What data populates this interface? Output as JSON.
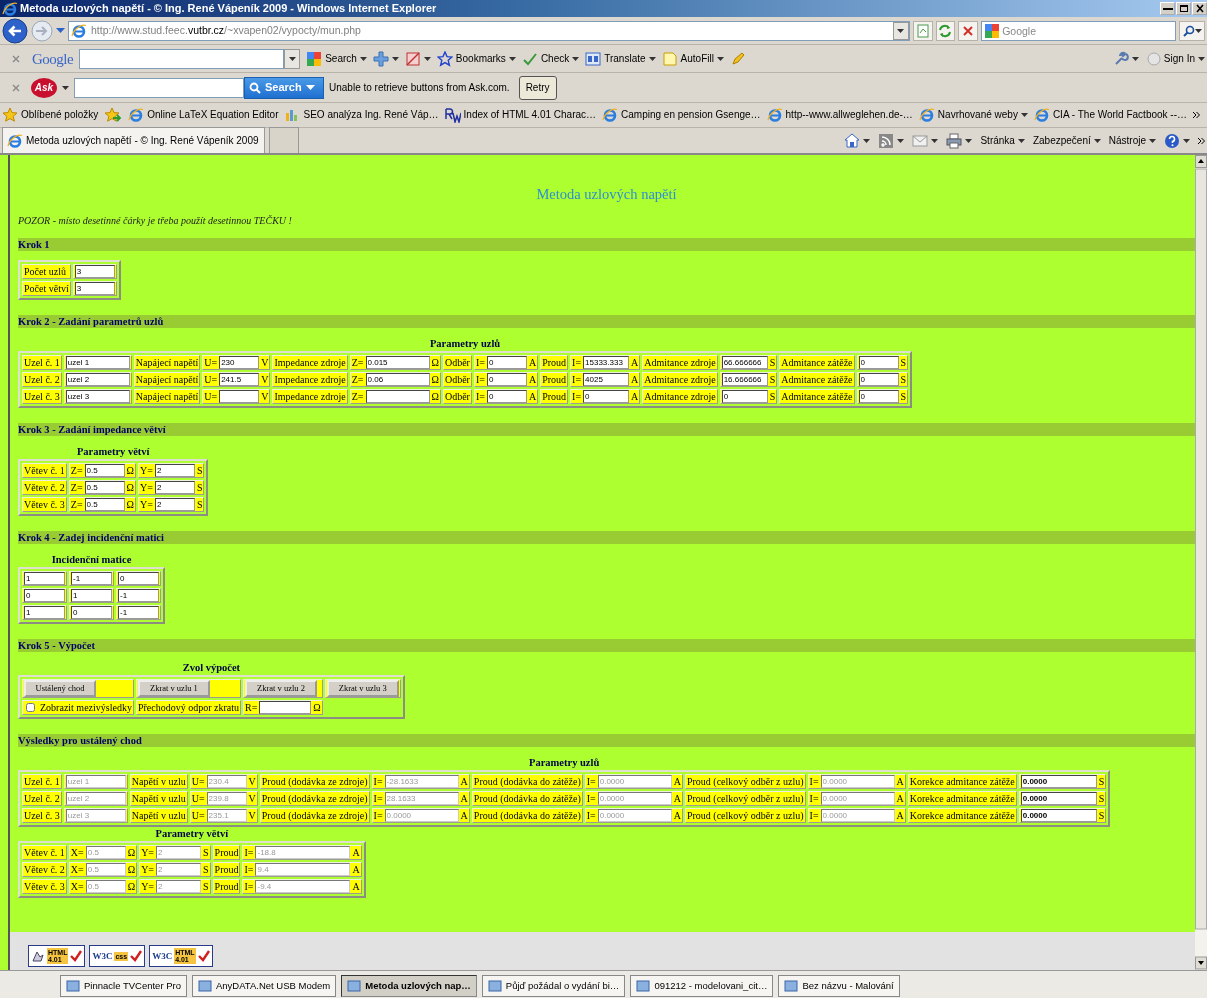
{
  "window": {
    "title": "Metoda uzlových napětí - © Ing. René Vápeník 2009 - Windows Internet Explorer"
  },
  "address_bar": {
    "url": "http://www.stud.feec.**vutbr.cz**/~xvapen02/vypocty/mun.php",
    "search_placeholder": "Google"
  },
  "google_toolbar": {
    "logo": "Google",
    "buttons": [
      {
        "kind": "search",
        "label": "Search"
      },
      {
        "kind": "bookmarks",
        "label": "Bookmarks"
      },
      {
        "kind": "check",
        "label": "Check"
      },
      {
        "kind": "translate",
        "label": "Translate"
      },
      {
        "kind": "autofill",
        "label": "AutoFill"
      }
    ],
    "sign_in": "Sign In"
  },
  "ask_toolbar": {
    "logo": "Ask",
    "search_button": "Search",
    "message": "Unable to retrieve buttons from Ask.com.",
    "retry": "Retry"
  },
  "favorites": {
    "label": "Oblíbené položky",
    "links": [
      {
        "kind": "page",
        "text": "Online LaTeX Equation Editor"
      },
      {
        "kind": "chart",
        "text": "SEO analýza Ing. René Váp…"
      },
      {
        "kind": "rw",
        "text": "Index of HTML 4.01 Charac…"
      },
      {
        "kind": "page",
        "text": "Camping en pension Gsenge…"
      },
      {
        "kind": "page",
        "text": "http--www.allweglehen.de-…"
      },
      {
        "kind": "menu",
        "text": "Navrhované weby"
      },
      {
        "kind": "page",
        "text": "CIA - The World Factbook --…"
      }
    ]
  },
  "tabs": [
    {
      "label": "Metoda uzlových napětí - © Ing. René Vápeník 2009",
      "selected": true
    }
  ],
  "command_bar": {
    "menus": [
      "Stránka",
      "Zabezpečení",
      "Nástroje"
    ]
  },
  "page": {
    "title": "Metoda uzlových napětí",
    "warning": "POZOR - místo desetinné čárky je třeba použít desetinnou TEČKU !",
    "sections": [
      {
        "heading": "Krok 1",
        "blocks": [
          {
            "rows": [
              [
                [
                  {
                    "kind": "text",
                    "text": "Počet uzlů"
                  }
                ],
                [
                  {
                    "kind": "input",
                    "value": "3",
                    "disabled": false
                  }
                ]
              ],
              [
                [
                  {
                    "kind": "text",
                    "text": "Počet větví"
                  }
                ],
                [
                  {
                    "kind": "input",
                    "value": "3",
                    "disabled": false
                  }
                ]
              ]
            ]
          }
        ]
      },
      {
        "heading": "Krok 2 - Zadání parametrů uzlů",
        "blocks": [
          {
            "caption": "Parametry uzlů",
            "rows": [
              [
                [
                  {
                    "kind": "text",
                    "text": "Uzel č. 1"
                  }
                ],
                [
                  {
                    "kind": "input",
                    "value": "uzel 1",
                    "disabled": false
                  }
                ],
                [
                  {
                    "kind": "text",
                    "text": "Napájecí napětí"
                  }
                ],
                [
                  {
                    "kind": "text",
                    "text": "U="
                  },
                  {
                    "kind": "input",
                    "value": "230",
                    "disabled": false
                  },
                  {
                    "kind": "text",
                    "text": "V"
                  }
                ],
                [
                  {
                    "kind": "text",
                    "text": "Impedance zdroje"
                  }
                ],
                [
                  {
                    "kind": "text",
                    "text": "Z="
                  },
                  {
                    "kind": "input",
                    "value": "0.015",
                    "disabled": false
                  },
                  {
                    "kind": "text",
                    "text": "Ω"
                  }
                ],
                [
                  {
                    "kind": "text",
                    "text": "Odběr"
                  }
                ],
                [
                  {
                    "kind": "text",
                    "text": "I="
                  },
                  {
                    "kind": "input",
                    "value": "0",
                    "disabled": false
                  },
                  {
                    "kind": "text",
                    "text": "A"
                  }
                ],
                [
                  {
                    "kind": "text",
                    "text": "Proud"
                  }
                ],
                [
                  {
                    "kind": "text",
                    "text": "I="
                  },
                  {
                    "kind": "input",
                    "value": "15333.333",
                    "disabled": false
                  },
                  {
                    "kind": "text",
                    "text": "A"
                  }
                ],
                [
                  {
                    "kind": "text",
                    "text": "Admitance zdroje"
                  }
                ],
                [
                  {
                    "kind": "input",
                    "value": "66.666666",
                    "disabled": false
                  },
                  {
                    "kind": "text",
                    "text": "S"
                  }
                ],
                [
                  {
                    "kind": "text",
                    "text": "Admitance zátěže"
                  }
                ],
                [
                  {
                    "kind": "input",
                    "value": "0",
                    "disabled": false
                  },
                  {
                    "kind": "text",
                    "text": "S"
                  }
                ]
              ],
              [
                [
                  {
                    "kind": "text",
                    "text": "Uzel č. 2"
                  }
                ],
                [
                  {
                    "kind": "input",
                    "value": "uzel 2",
                    "disabled": false
                  }
                ],
                [
                  {
                    "kind": "text",
                    "text": "Napájecí napětí"
                  }
                ],
                [
                  {
                    "kind": "text",
                    "text": "U="
                  },
                  {
                    "kind": "input",
                    "value": "241.5",
                    "disabled": false
                  },
                  {
                    "kind": "text",
                    "text": "V"
                  }
                ],
                [
                  {
                    "kind": "text",
                    "text": "Impedance zdroje"
                  }
                ],
                [
                  {
                    "kind": "text",
                    "text": "Z="
                  },
                  {
                    "kind": "input",
                    "value": "0.06",
                    "disabled": false
                  },
                  {
                    "kind": "text",
                    "text": "Ω"
                  }
                ],
                [
                  {
                    "kind": "text",
                    "text": "Odběr"
                  }
                ],
                [
                  {
                    "kind": "text",
                    "text": "I="
                  },
                  {
                    "kind": "input",
                    "value": "0",
                    "disabled": false
                  },
                  {
                    "kind": "text",
                    "text": "A"
                  }
                ],
                [
                  {
                    "kind": "text",
                    "text": "Proud"
                  }
                ],
                [
                  {
                    "kind": "text",
                    "text": "I="
                  },
                  {
                    "kind": "input",
                    "value": "4025",
                    "disabled": false
                  },
                  {
                    "kind": "text",
                    "text": "A"
                  }
                ],
                [
                  {
                    "kind": "text",
                    "text": "Admitance zdroje"
                  }
                ],
                [
                  {
                    "kind": "input",
                    "value": "16.666666",
                    "disabled": false
                  },
                  {
                    "kind": "text",
                    "text": "S"
                  }
                ],
                [
                  {
                    "kind": "text",
                    "text": "Admitance zátěže"
                  }
                ],
                [
                  {
                    "kind": "input",
                    "value": "0",
                    "disabled": false
                  },
                  {
                    "kind": "text",
                    "text": "S"
                  }
                ]
              ],
              [
                [
                  {
                    "kind": "text",
                    "text": "Uzel č. 3"
                  }
                ],
                [
                  {
                    "kind": "input",
                    "value": "uzel 3",
                    "disabled": false
                  }
                ],
                [
                  {
                    "kind": "text",
                    "text": "Napájecí napětí"
                  }
                ],
                [
                  {
                    "kind": "text",
                    "text": "U="
                  },
                  {
                    "kind": "input",
                    "disabled": false
                  },
                  {
                    "kind": "text",
                    "text": "V"
                  }
                ],
                [
                  {
                    "kind": "text",
                    "text": "Impedance zdroje"
                  }
                ],
                [
                  {
                    "kind": "text",
                    "text": "Z="
                  },
                  {
                    "kind": "input",
                    "disabled": false
                  },
                  {
                    "kind": "text",
                    "text": "Ω"
                  }
                ],
                [
                  {
                    "kind": "text",
                    "text": "Odběr"
                  }
                ],
                [
                  {
                    "kind": "text",
                    "text": "I="
                  },
                  {
                    "kind": "input",
                    "value": "0",
                    "disabled": false
                  },
                  {
                    "kind": "text",
                    "text": "A"
                  }
                ],
                [
                  {
                    "kind": "text",
                    "text": "Proud"
                  }
                ],
                [
                  {
                    "kind": "text",
                    "text": "I="
                  },
                  {
                    "kind": "input",
                    "value": "0",
                    "disabled": false
                  },
                  {
                    "kind": "text",
                    "text": "A"
                  }
                ],
                [
                  {
                    "kind": "text",
                    "text": "Admitance zdroje"
                  }
                ],
                [
                  {
                    "kind": "input",
                    "value": "0",
                    "disabled": false
                  },
                  {
                    "kind": "text",
                    "text": "S"
                  }
                ],
                [
                  {
                    "kind": "text",
                    "text": "Admitance zátěže"
                  }
                ],
                [
                  {
                    "kind": "input",
                    "value": "0",
                    "disabled": false
                  },
                  {
                    "kind": "text",
                    "text": "S"
                  }
                ]
              ]
            ]
          }
        ]
      },
      {
        "heading": "Krok 3 - Zadání impedance větví",
        "blocks": [
          {
            "caption": "Parametry větví",
            "rows": [
              [
                [
                  {
                    "kind": "text",
                    "text": "Větev č. 1"
                  }
                ],
                [
                  {
                    "kind": "text",
                    "text": "Z="
                  },
                  {
                    "kind": "input",
                    "value": "0.5",
                    "disabled": false
                  },
                  {
                    "kind": "text",
                    "text": "Ω"
                  }
                ],
                [
                  {
                    "kind": "text",
                    "text": "Y="
                  },
                  {
                    "kind": "input",
                    "value": "2",
                    "disabled": false
                  },
                  {
                    "kind": "text",
                    "text": "S"
                  }
                ]
              ],
              [
                [
                  {
                    "kind": "text",
                    "text": "Větev č. 2"
                  }
                ],
                [
                  {
                    "kind": "text",
                    "text": "Z="
                  },
                  {
                    "kind": "input",
                    "value": "0.5",
                    "disabled": false
                  },
                  {
                    "kind": "text",
                    "text": "Ω"
                  }
                ],
                [
                  {
                    "kind": "text",
                    "text": "Y="
                  },
                  {
                    "kind": "input",
                    "value": "2",
                    "disabled": false
                  },
                  {
                    "kind": "text",
                    "text": "S"
                  }
                ]
              ],
              [
                [
                  {
                    "kind": "text",
                    "text": "Větev č. 3"
                  }
                ],
                [
                  {
                    "kind": "text",
                    "text": "Z="
                  },
                  {
                    "kind": "input",
                    "value": "0.5",
                    "disabled": false
                  },
                  {
                    "kind": "text",
                    "text": "Ω"
                  }
                ],
                [
                  {
                    "kind": "text",
                    "text": "Y="
                  },
                  {
                    "kind": "input",
                    "value": "2",
                    "disabled": false
                  },
                  {
                    "kind": "text",
                    "text": "S"
                  }
                ]
              ]
            ]
          }
        ]
      },
      {
        "heading": "Krok 4 - Zadej incidenční matici",
        "blocks": [
          {
            "caption": "Incidenční matice",
            "rows": [
              [
                [
                  {
                    "kind": "input",
                    "value": "1",
                    "disabled": false
                  }
                ],
                [
                  {
                    "kind": "input",
                    "value": "-1",
                    "disabled": false
                  }
                ],
                [
                  {
                    "kind": "input",
                    "value": "0",
                    "disabled": false
                  }
                ]
              ],
              [
                [
                  {
                    "kind": "input",
                    "value": "0",
                    "disabled": false
                  }
                ],
                [
                  {
                    "kind": "input",
                    "value": "1",
                    "disabled": false
                  }
                ],
                [
                  {
                    "kind": "input",
                    "value": "-1",
                    "disabled": false
                  }
                ]
              ],
              [
                [
                  {
                    "kind": "input",
                    "value": "1",
                    "disabled": false
                  }
                ],
                [
                  {
                    "kind": "input",
                    "value": "0",
                    "disabled": false
                  }
                ],
                [
                  {
                    "kind": "input",
                    "value": "-1",
                    "disabled": false
                  }
                ]
              ]
            ]
          }
        ]
      },
      {
        "heading": "Krok 5 - Výpočet",
        "blocks": [
          {
            "caption": "Zvol výpočet",
            "rows": [
              [
                [
                  {
                    "kind": "button",
                    "label": "Ustálený chod"
                  }
                ],
                [
                  {
                    "kind": "button",
                    "label": "Zkrat v uzlu 1"
                  }
                ],
                [
                  {
                    "kind": "button",
                    "label": "Zkrat v uzlu 2"
                  }
                ],
                [
                  {
                    "kind": "button",
                    "label": "Zkrat v uzlu 3"
                  }
                ]
              ],
              [
                [
                  {
                    "kind": "checkbox",
                    "label": "Zobrazit mezivýsledky",
                    "checked": false
                  }
                ],
                [
                  {
                    "kind": "text",
                    "text": "Přechodový odpor zkratu"
                  }
                ],
                [
                  {
                    "kind": "text",
                    "text": "R="
                  },
                  {
                    "kind": "input",
                    "disabled": false
                  },
                  {
                    "kind": "text",
                    "text": "Ω"
                  }
                ]
              ]
            ]
          }
        ]
      },
      {
        "heading": "Výsledky pro ustálený chod",
        "blocks": [
          {
            "caption": "Parametry uzlů",
            "rows": [
              [
                [
                  {
                    "kind": "text",
                    "text": "Uzel č. 1"
                  }
                ],
                [
                  {
                    "kind": "input",
                    "value": "uzel 1",
                    "disabled": true
                  }
                ],
                [
                  {
                    "kind": "text",
                    "text": "Napětí v uzlu"
                  }
                ],
                [
                  {
                    "kind": "text",
                    "text": "U="
                  },
                  {
                    "kind": "input",
                    "value": "230.4",
                    "disabled": true
                  },
                  {
                    "kind": "text",
                    "text": "V"
                  }
                ],
                [
                  {
                    "kind": "text",
                    "text": "Proud (dodávka ze zdroje)"
                  }
                ],
                [
                  {
                    "kind": "text",
                    "text": "I="
                  },
                  {
                    "kind": "input",
                    "value": "-28.1633",
                    "disabled": true
                  },
                  {
                    "kind": "text",
                    "text": "A"
                  }
                ],
                [
                  {
                    "kind": "text",
                    "text": "Proud (dodávka do zátěže)"
                  }
                ],
                [
                  {
                    "kind": "text",
                    "text": "I="
                  },
                  {
                    "kind": "input",
                    "value": "0.0000",
                    "disabled": true
                  },
                  {
                    "kind": "text",
                    "text": "A"
                  }
                ],
                [
                  {
                    "kind": "text",
                    "text": "Proud (celkový odběr z uzlu)"
                  }
                ],
                [
                  {
                    "kind": "text",
                    "text": "I="
                  },
                  {
                    "kind": "input",
                    "value": "0.0000",
                    "disabled": true
                  },
                  {
                    "kind": "text",
                    "text": "A"
                  }
                ],
                [
                  {
                    "kind": "text",
                    "text": "Korekce admitance zátěže"
                  }
                ],
                [
                  {
                    "kind": "input",
                    "value": "0.0000",
                    "disabled": false
                  },
                  {
                    "kind": "text",
                    "text": "S"
                  }
                ]
              ],
              [
                [
                  {
                    "kind": "text",
                    "text": "Uzel č. 2"
                  }
                ],
                [
                  {
                    "kind": "input",
                    "value": "uzel 2",
                    "disabled": true
                  }
                ],
                [
                  {
                    "kind": "text",
                    "text": "Napětí v uzlu"
                  }
                ],
                [
                  {
                    "kind": "text",
                    "text": "U="
                  },
                  {
                    "kind": "input",
                    "value": "239.8",
                    "disabled": true
                  },
                  {
                    "kind": "text",
                    "text": "V"
                  }
                ],
                [
                  {
                    "kind": "text",
                    "text": "Proud (dodávka ze zdroje)"
                  }
                ],
                [
                  {
                    "kind": "text",
                    "text": "I="
                  },
                  {
                    "kind": "input",
                    "value": "28.1633",
                    "disabled": true
                  },
                  {
                    "kind": "text",
                    "text": "A"
                  }
                ],
                [
                  {
                    "kind": "text",
                    "text": "Proud (dodávka do zátěže)"
                  }
                ],
                [
                  {
                    "kind": "text",
                    "text": "I="
                  },
                  {
                    "kind": "input",
                    "value": "0.0000",
                    "disabled": true
                  },
                  {
                    "kind": "text",
                    "text": "A"
                  }
                ],
                [
                  {
                    "kind": "text",
                    "text": "Proud (celkový odběr z uzlu)"
                  }
                ],
                [
                  {
                    "kind": "text",
                    "text": "I="
                  },
                  {
                    "kind": "input",
                    "value": "0.0000",
                    "disabled": true
                  },
                  {
                    "kind": "text",
                    "text": "A"
                  }
                ],
                [
                  {
                    "kind": "text",
                    "text": "Korekce admitance zátěže"
                  }
                ],
                [
                  {
                    "kind": "input",
                    "value": "0.0000",
                    "disabled": false
                  },
                  {
                    "kind": "text",
                    "text": "S"
                  }
                ]
              ],
              [
                [
                  {
                    "kind": "text",
                    "text": "Uzel č. 3"
                  }
                ],
                [
                  {
                    "kind": "input",
                    "value": "uzel 3",
                    "disabled": true
                  }
                ],
                [
                  {
                    "kind": "text",
                    "text": "Napětí v uzlu"
                  }
                ],
                [
                  {
                    "kind": "text",
                    "text": "U="
                  },
                  {
                    "kind": "input",
                    "value": "235.1",
                    "disabled": true
                  },
                  {
                    "kind": "text",
                    "text": "V"
                  }
                ],
                [
                  {
                    "kind": "text",
                    "text": "Proud (dodávka ze zdroje)"
                  }
                ],
                [
                  {
                    "kind": "text",
                    "text": "I="
                  },
                  {
                    "kind": "input",
                    "value": "0.0000",
                    "disabled": true
                  },
                  {
                    "kind": "text",
                    "text": "A"
                  }
                ],
                [
                  {
                    "kind": "text",
                    "text": "Proud (dodávka do zátěže)"
                  }
                ],
                [
                  {
                    "kind": "text",
                    "text": "I="
                  },
                  {
                    "kind": "input",
                    "value": "0.0000",
                    "disabled": true
                  },
                  {
                    "kind": "text",
                    "text": "A"
                  }
                ],
                [
                  {
                    "kind": "text",
                    "text": "Proud (celkový odběr z uzlu)"
                  }
                ],
                [
                  {
                    "kind": "text",
                    "text": "I="
                  },
                  {
                    "kind": "input",
                    "value": "0.0000",
                    "disabled": true
                  },
                  {
                    "kind": "text",
                    "text": "A"
                  }
                ],
                [
                  {
                    "kind": "text",
                    "text": "Korekce admitance zátěže"
                  }
                ],
                [
                  {
                    "kind": "input",
                    "value": "0.0000",
                    "disabled": false
                  },
                  {
                    "kind": "text",
                    "text": "S"
                  }
                ]
              ]
            ]
          },
          {
            "caption": "Parametry větví",
            "rows": [
              [
                [
                  {
                    "kind": "text",
                    "text": "Větev č. 1"
                  }
                ],
                [
                  {
                    "kind": "text",
                    "text": "X="
                  },
                  {
                    "kind": "input",
                    "value": "0.5",
                    "disabled": true
                  },
                  {
                    "kind": "text",
                    "text": "Ω"
                  }
                ],
                [
                  {
                    "kind": "text",
                    "text": "Y="
                  },
                  {
                    "kind": "input",
                    "value": "2",
                    "disabled": true
                  },
                  {
                    "kind": "text",
                    "text": "S"
                  }
                ],
                [
                  {
                    "kind": "text",
                    "text": "Proud"
                  }
                ],
                [
                  {
                    "kind": "text",
                    "text": "I="
                  },
                  {
                    "kind": "input",
                    "value": "-18.8",
                    "disabled": true
                  },
                  {
                    "kind": "text",
                    "text": "A"
                  }
                ]
              ],
              [
                [
                  {
                    "kind": "text",
                    "text": "Větev č. 2"
                  }
                ],
                [
                  {
                    "kind": "text",
                    "text": "X="
                  },
                  {
                    "kind": "input",
                    "value": "0.5",
                    "disabled": true
                  },
                  {
                    "kind": "text",
                    "text": "Ω"
                  }
                ],
                [
                  {
                    "kind": "text",
                    "text": "Y="
                  },
                  {
                    "kind": "input",
                    "value": "2",
                    "disabled": true
                  },
                  {
                    "kind": "text",
                    "text": "S"
                  }
                ],
                [
                  {
                    "kind": "text",
                    "text": "Proud"
                  }
                ],
                [
                  {
                    "kind": "text",
                    "text": "I="
                  },
                  {
                    "kind": "input",
                    "value": "9.4",
                    "disabled": true
                  },
                  {
                    "kind": "text",
                    "text": "A"
                  }
                ]
              ],
              [
                [
                  {
                    "kind": "text",
                    "text": "Větev č. 3"
                  }
                ],
                [
                  {
                    "kind": "text",
                    "text": "X="
                  },
                  {
                    "kind": "input",
                    "value": "0.5",
                    "disabled": true
                  },
                  {
                    "kind": "text",
                    "text": "Ω"
                  }
                ],
                [
                  {
                    "kind": "text",
                    "text": "Y="
                  },
                  {
                    "kind": "input",
                    "value": "2",
                    "disabled": true
                  },
                  {
                    "kind": "text",
                    "text": "S"
                  }
                ],
                [
                  {
                    "kind": "text",
                    "text": "Proud"
                  }
                ],
                [
                  {
                    "kind": "text",
                    "text": "I="
                  },
                  {
                    "kind": "input",
                    "value": "-9.4",
                    "disabled": true
                  },
                  {
                    "kind": "text",
                    "text": "A"
                  }
                ]
              ]
            ]
          }
        ]
      }
    ],
    "badges": [
      {
        "lines": [
          "HTML",
          "4.01"
        ]
      },
      {
        "prefix": "W3C",
        "lines": [
          "css"
        ]
      },
      {
        "prefix": "W3C",
        "lines": [
          "HTML",
          "4.01"
        ]
      }
    ]
  },
  "taskbar": [
    {
      "label": "Pinnacle TVCenter Pro",
      "selected": false
    },
    {
      "label": "AnyDATA.Net USB Modem",
      "selected": false
    },
    {
      "label": "Metoda uzlových nap…",
      "selected": true
    },
    {
      "label": "Půjď požádal o vydání bi…",
      "selected": false
    },
    {
      "label": "091212 - modelovani_cit…",
      "selected": false
    },
    {
      "label": "Bez názvu - Malování",
      "selected": false
    }
  ]
}
